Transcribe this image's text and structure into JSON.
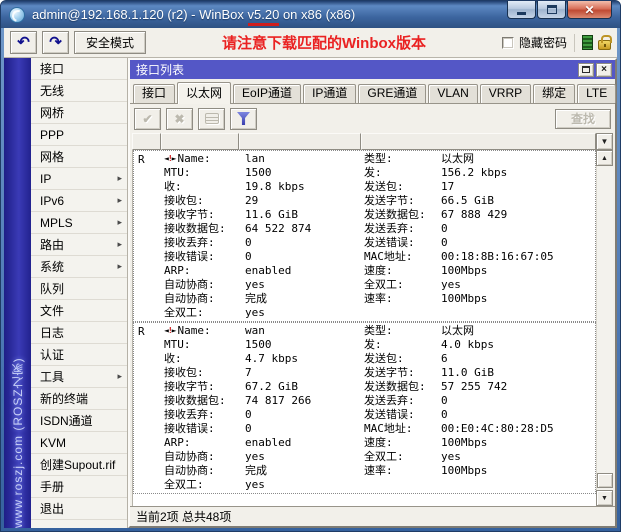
{
  "titlebar": {
    "title_prefix": "admin@192.168.1.120 (r2) - WinBox ",
    "version": "v5.20",
    "title_suffix": " on x86 (x86)"
  },
  "toolbar": {
    "safe_mode": "安全模式",
    "notice": "请注意下载匹配的Winbox版本",
    "hide_password": "隐藏密码"
  },
  "watermark": "www.roszj.com (ROSZ之家)",
  "icons": {
    "undo": "↶",
    "redo": "↷",
    "enable": "✔",
    "disable": "✖",
    "dropdown": "▼",
    "scroll_up": "▲",
    "scroll_down": "▼",
    "submenu_arrow": "▸"
  },
  "colors": {
    "panel_title_bg": "#5457c6",
    "notice_red": "#ea2222",
    "watermark_strip_blue": "#2a2aa0",
    "funnel_blue": "#3a3fae",
    "lock_gold": "#d8ac3a",
    "indicator_green": "#3f9c3f"
  },
  "sidebar": {
    "items": [
      {
        "key": "interfaces",
        "label": "接口",
        "submenu": false
      },
      {
        "key": "wireless",
        "label": "无线",
        "submenu": false
      },
      {
        "key": "bridge",
        "label": "网桥",
        "submenu": false
      },
      {
        "key": "ppp",
        "label": "PPP",
        "submenu": false
      },
      {
        "key": "mesh",
        "label": "网格",
        "submenu": false
      },
      {
        "key": "ip",
        "label": "IP",
        "submenu": true
      },
      {
        "key": "ipv6",
        "label": "IPv6",
        "submenu": true
      },
      {
        "key": "mpls",
        "label": "MPLS",
        "submenu": true
      },
      {
        "key": "routing",
        "label": "路由",
        "submenu": true
      },
      {
        "key": "system",
        "label": "系统",
        "submenu": true
      },
      {
        "key": "queues",
        "label": "队列",
        "submenu": false
      },
      {
        "key": "files",
        "label": "文件",
        "submenu": false
      },
      {
        "key": "log",
        "label": "日志",
        "submenu": false
      },
      {
        "key": "radius",
        "label": "认证",
        "submenu": false
      },
      {
        "key": "tools",
        "label": "工具",
        "submenu": true
      },
      {
        "key": "new-terminal",
        "label": "新的终端",
        "submenu": false
      },
      {
        "key": "isdn-channels",
        "label": "ISDN通道",
        "submenu": false
      },
      {
        "key": "kvm",
        "label": "KVM",
        "submenu": false
      },
      {
        "key": "make-supout",
        "label": "创建Supout.rif",
        "submenu": false
      },
      {
        "key": "manual",
        "label": "手册",
        "submenu": false
      },
      {
        "key": "exit",
        "label": "退出",
        "submenu": false
      }
    ]
  },
  "panel": {
    "title": "接口列表",
    "tabs": [
      {
        "key": "interface",
        "label": "接口",
        "active": false
      },
      {
        "key": "ethernet",
        "label": "以太网",
        "active": true
      },
      {
        "key": "eoip-tunnel",
        "label": "EoIP通道",
        "active": false
      },
      {
        "key": "ip-tunnel",
        "label": "IP通道",
        "active": false
      },
      {
        "key": "gre-tunnel",
        "label": "GRE通道",
        "active": false
      },
      {
        "key": "vlan",
        "label": "VLAN",
        "active": false
      },
      {
        "key": "vrrp",
        "label": "VRRP",
        "active": false
      },
      {
        "key": "bonding",
        "label": "绑定",
        "active": false
      },
      {
        "key": "lte",
        "label": "LTE",
        "active": false
      }
    ],
    "find": "查找",
    "status": "当前2项 总共48项",
    "rows": [
      {
        "key": "lan",
        "flag": "R",
        "left": [
          {
            "label": "Name:",
            "value": "lan",
            "icon": true
          },
          {
            "label": "MTU:",
            "value": "1500"
          },
          {
            "label": "收:",
            "value": "19.8 kbps"
          },
          {
            "label": "接收包:",
            "value": "29"
          },
          {
            "label": "接收字节:",
            "value": "11.6 GiB"
          },
          {
            "label": "接收数据包:",
            "value": "64 522 874"
          },
          {
            "label": "接收丢弃:",
            "value": "0"
          },
          {
            "label": "接收错误:",
            "value": "0"
          },
          {
            "label": "ARP:",
            "value": "enabled"
          },
          {
            "label": "自动协商:",
            "value": "yes"
          },
          {
            "label": "自动协商:",
            "value": "完成"
          },
          {
            "label": "全双工:",
            "value": "yes"
          }
        ],
        "right": [
          {
            "label": "类型:",
            "value": "以太网"
          },
          {
            "label": "发:",
            "value": "156.2 kbps"
          },
          {
            "label": "发送包:",
            "value": "17"
          },
          {
            "label": "发送字节:",
            "value": "66.5 GiB"
          },
          {
            "label": "发送数据包:",
            "value": "67 888 429"
          },
          {
            "label": "发送丢弃:",
            "value": "0"
          },
          {
            "label": "发送错误:",
            "value": "0"
          },
          {
            "label": "MAC地址:",
            "value": "00:18:8B:16:67:05"
          },
          {
            "label": "速度:",
            "value": "100Mbps"
          },
          {
            "label": "全双工:",
            "value": "yes"
          },
          {
            "label": "速率:",
            "value": "100Mbps"
          }
        ]
      },
      {
        "key": "wan",
        "flag": "R",
        "left": [
          {
            "label": "Name:",
            "value": "wan",
            "icon": true
          },
          {
            "label": "MTU:",
            "value": "1500"
          },
          {
            "label": "收:",
            "value": "4.7 kbps"
          },
          {
            "label": "接收包:",
            "value": "7"
          },
          {
            "label": "接收字节:",
            "value": "67.2 GiB"
          },
          {
            "label": "接收数据包:",
            "value": "74 817 266"
          },
          {
            "label": "接收丢弃:",
            "value": "0"
          },
          {
            "label": "接收错误:",
            "value": "0"
          },
          {
            "label": "ARP:",
            "value": "enabled"
          },
          {
            "label": "自动协商:",
            "value": "yes"
          },
          {
            "label": "自动协商:",
            "value": "完成"
          },
          {
            "label": "全双工:",
            "value": "yes"
          }
        ],
        "right": [
          {
            "label": "类型:",
            "value": "以太网"
          },
          {
            "label": "发:",
            "value": "4.0 kbps"
          },
          {
            "label": "发送包:",
            "value": "6"
          },
          {
            "label": "发送字节:",
            "value": "11.0 GiB"
          },
          {
            "label": "发送数据包:",
            "value": "57 255 742"
          },
          {
            "label": "发送丢弃:",
            "value": "0"
          },
          {
            "label": "发送错误:",
            "value": "0"
          },
          {
            "label": "MAC地址:",
            "value": "00:E0:4C:80:28:D5"
          },
          {
            "label": "速度:",
            "value": "100Mbps"
          },
          {
            "label": "全双工:",
            "value": "yes"
          },
          {
            "label": "速率:",
            "value": "100Mbps"
          }
        ]
      }
    ]
  }
}
